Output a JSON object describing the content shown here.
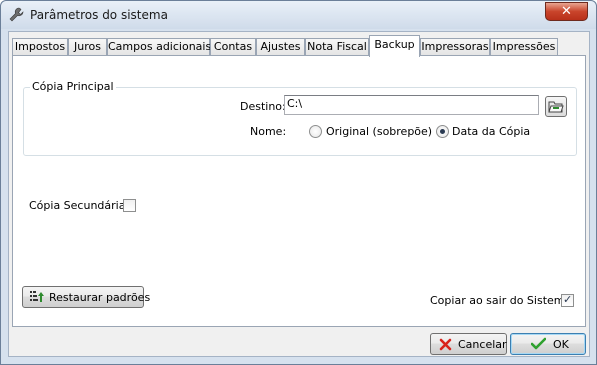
{
  "window": {
    "title": "Parâmetros do sistema",
    "close_symbol": "✕"
  },
  "tabs": [
    {
      "label": "Impostos",
      "active": false
    },
    {
      "label": "Juros",
      "active": false
    },
    {
      "label": "Campos adicionais",
      "active": false
    },
    {
      "label": "Contas",
      "active": false
    },
    {
      "label": "Ajustes",
      "active": false
    },
    {
      "label": "Nota Fiscal",
      "active": false
    },
    {
      "label": "Backup",
      "active": true
    },
    {
      "label": "Impressoras",
      "active": false
    },
    {
      "label": "Impressões",
      "active": false
    }
  ],
  "backup": {
    "primary": {
      "group_title": "Cópia Principal",
      "destino_label": "Destino:",
      "destino_value": "C:\\",
      "nome_label": "Nome:",
      "option_original": "Original (sobrepõe)",
      "option_data": "Data da Cópia",
      "selected_option": "Data da Cópia"
    },
    "secondary": {
      "label": "Cópia Secundária",
      "checked": false
    },
    "restore_label": "Restaurar padrões",
    "copy_on_exit_label": "Copiar ao sair do Sistema",
    "copy_on_exit_checked": true
  },
  "footer": {
    "cancel_label": "Cancelar",
    "ok_label": "OK"
  },
  "colors": {
    "frame": "#d6e1ee",
    "close": "#c9442b",
    "cancel_icon": "#d9231c",
    "ok_icon": "#2fa12f",
    "restore_icon": "#2f8a2f"
  },
  "icons": {
    "app": "wrench-icon",
    "browse": "folder-open-icon",
    "restore": "sort-arrow-up-icon",
    "cancel": "x-mark-icon",
    "ok": "checkmark-icon"
  }
}
